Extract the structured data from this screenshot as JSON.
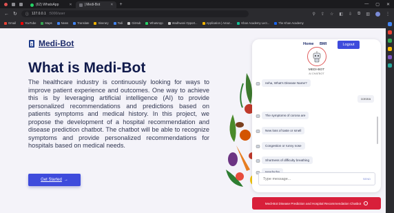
{
  "browser": {
    "tabs": [
      {
        "label": "(62) WhatsApp",
        "active": false
      },
      {
        "label": "| Medi-Bot",
        "active": true
      }
    ],
    "url": {
      "host": "127.0.0.1",
      "path": ":5000/user"
    },
    "bookmarks": [
      {
        "label": "Gmail",
        "color": "#ea4335"
      },
      {
        "label": "YouTube",
        "color": "#ff0000"
      },
      {
        "label": "Maps",
        "color": "#34a853"
      },
      {
        "label": "News",
        "color": "#4285f4"
      },
      {
        "label": "Translate",
        "color": "#4285f4"
      },
      {
        "label": "Itinerary",
        "color": "#f4b400"
      },
      {
        "label": "Todi",
        "color": "#4285f4"
      },
      {
        "label": "GitHub",
        "color": "#cccccc"
      },
      {
        "label": "WhatsApp",
        "color": "#25d366"
      },
      {
        "label": "Wadhwani Opport...",
        "color": "#cccccc"
      },
      {
        "label": "Application | Amaz...",
        "color": "#f4b400"
      },
      {
        "label": "Khan Academy Lect...",
        "color": "#14bf96"
      },
      {
        "label": "The Khan Academy",
        "color": "#1865f2"
      }
    ]
  },
  "site": {
    "logo": "Medi-Bot",
    "title": "What is Medi-Bot",
    "body": "The healthcare industry is continuously looking for ways to improve patient experience and outcomes. One way to achieve this is by leveraging artificial intelligence (AI) to provide personalized recommendations and predictions based on patients symptoms and medical history. In this project, we propose the development of a hospital recommendation and disease prediction chatbot. The chatbot will be able to recognize symptoms and provide personalized recommendations for hospitals based on medical needs.",
    "cta": "Get Started",
    "cta_arrow": "→"
  },
  "chat": {
    "nav_home": "Home",
    "nav_bmi": "BMI",
    "logout": "Logout",
    "bot_name": "MEDI-BOT",
    "bot_status": "AI CHATBOT",
    "messages": [
      {
        "from": "bot",
        "text": "neha, What's Disease Name?"
      },
      {
        "from": "user",
        "text": "corona"
      },
      {
        "from": "bot",
        "text": "The symptoms of corona are"
      },
      {
        "from": "bot",
        "text": "New loss of taste or smell"
      },
      {
        "from": "bot",
        "text": "Congestion or runny nose"
      },
      {
        "from": "bot",
        "text": "Shortness of difficulty breathing"
      },
      {
        "from": "bot",
        "text": "Headache"
      }
    ],
    "input_placeholder": "Type message...",
    "send": "SEND"
  },
  "banner": "Medi-Bot Disease Prediction and Hospital Recommendation Chatbot"
}
